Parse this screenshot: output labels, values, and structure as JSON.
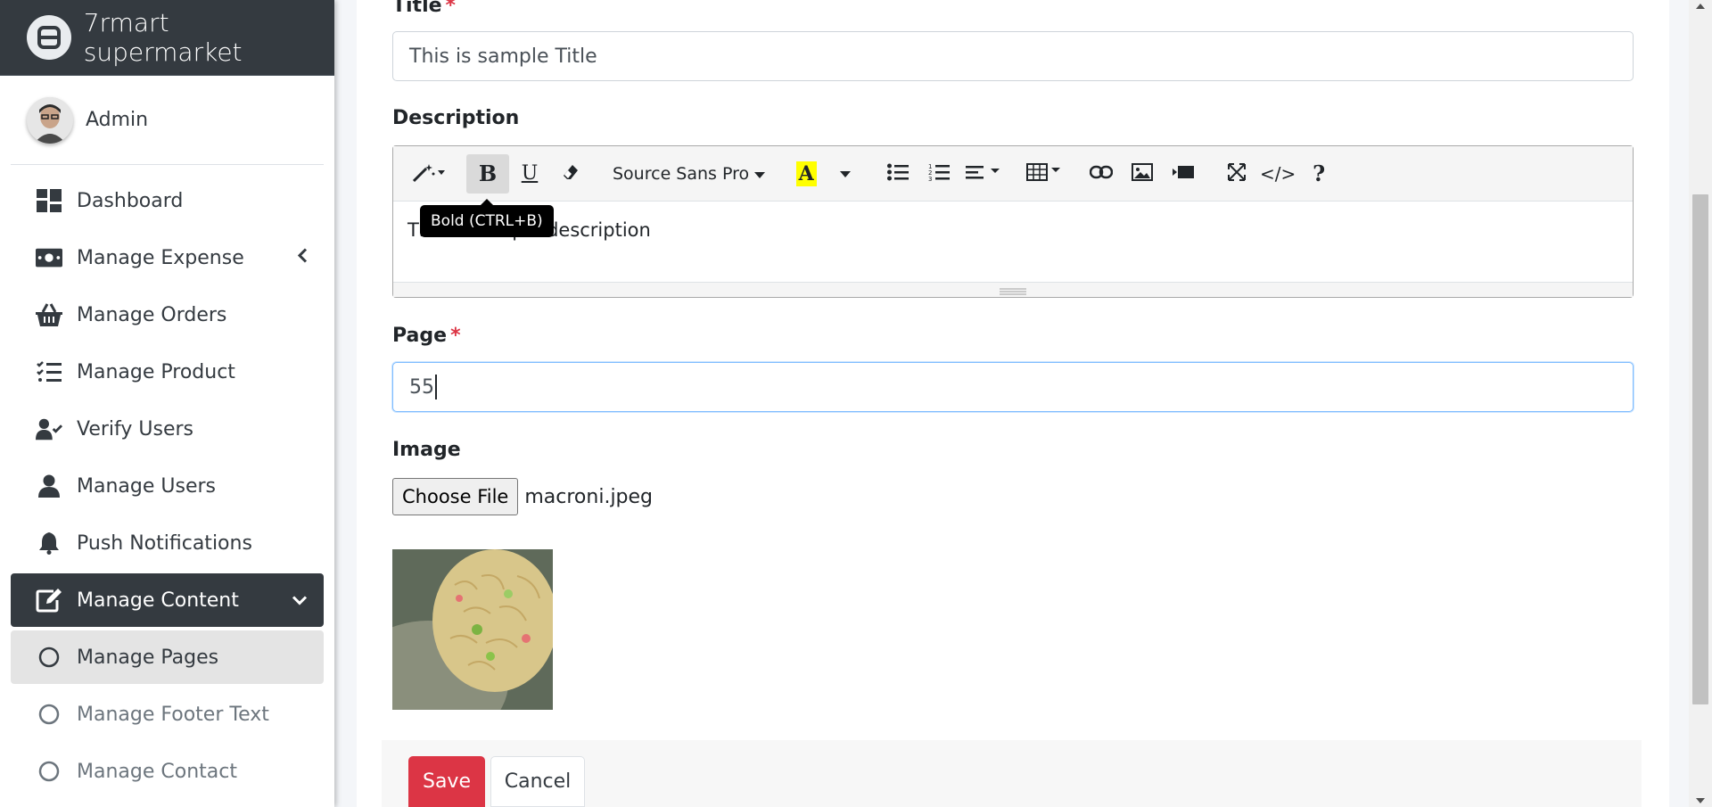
{
  "sidebar": {
    "brand": "7rmart supermarket",
    "user": "Admin",
    "items": [
      {
        "label": "Dashboard",
        "icon": "dashboard-icon"
      },
      {
        "label": "Manage Expense",
        "icon": "money-icon",
        "chevron": "chevron-left-icon"
      },
      {
        "label": "Manage Orders",
        "icon": "basket-icon"
      },
      {
        "label": "Manage Product",
        "icon": "list-check-icon"
      },
      {
        "label": "Verify Users",
        "icon": "user-check-icon"
      },
      {
        "label": "Manage Users",
        "icon": "user-icon"
      },
      {
        "label": "Push Notifications",
        "icon": "bell-icon"
      },
      {
        "label": "Manage Content",
        "icon": "edit-icon",
        "chevron": "chevron-down-icon",
        "active": true
      },
      {
        "label": "Manage Pages",
        "icon": "circle-icon",
        "selected": true
      },
      {
        "label": "Manage Footer Text",
        "icon": "circle-icon"
      },
      {
        "label": "Manage Contact",
        "icon": "circle-icon"
      }
    ]
  },
  "form": {
    "title_label": "Title",
    "title_value": "This is sample Title",
    "description_label": "Description",
    "description_value": "This is sample description",
    "page_label": "Page",
    "page_value": "55",
    "image_label": "Image",
    "choose_file_label": "Choose File",
    "file_name": "macroni.jpeg",
    "required_mark": "*"
  },
  "editor": {
    "font_name": "Source Sans Pro",
    "tooltip": "Bold (CTRL+B)",
    "highlight_color": "#ffff00"
  },
  "actions": {
    "save": "Save",
    "cancel": "Cancel"
  },
  "colors": {
    "sidebar_dark": "#343a40",
    "save": "#dc3545",
    "focus_border": "#80bdff"
  }
}
